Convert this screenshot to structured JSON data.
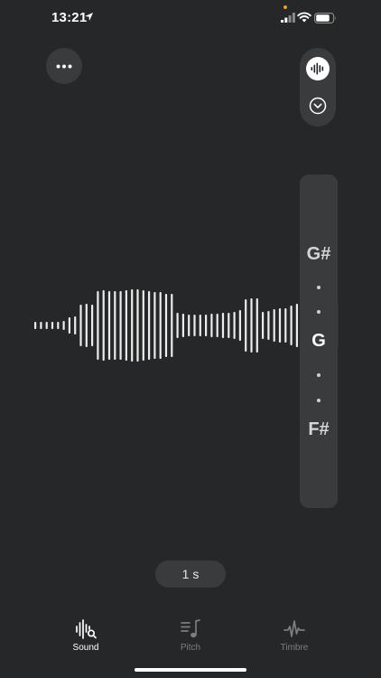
{
  "status": {
    "time": "13:21"
  },
  "pitch_meter": {
    "upper_note": "G#",
    "current_note": "G",
    "lower_note": "F#"
  },
  "time_window": {
    "label": "1 s"
  },
  "tabs": [
    {
      "label": "Sound",
      "icon": "sound-search-icon",
      "selected": true
    },
    {
      "label": "Pitch",
      "icon": "music-note-list-icon",
      "selected": false
    },
    {
      "label": "Timbre",
      "icon": "waveform-pulse-icon",
      "selected": false
    }
  ],
  "colors": {
    "background": "#262728",
    "surface": "#3a3b3d",
    "active": "#ffffff",
    "inactive": "#7d7e80"
  }
}
